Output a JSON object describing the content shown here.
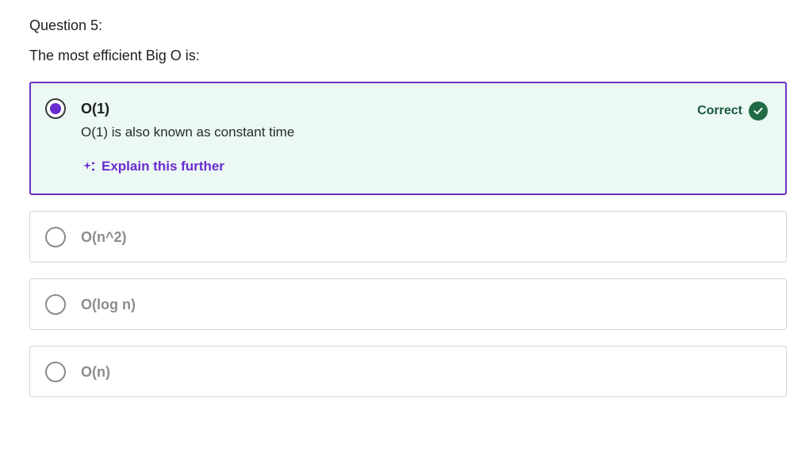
{
  "question": {
    "number_label": "Question 5:",
    "prompt": "The most efficient Big O is:"
  },
  "options": [
    {
      "label": "O(1)",
      "selected": true,
      "feedback": "O(1) is also known as constant time",
      "status_label": "Correct",
      "status_icon": "check-circle-icon",
      "explain_label": "Explain this further",
      "explain_icon": "sparkle-icon"
    },
    {
      "label": "O(n^2)",
      "selected": false
    },
    {
      "label": "O(log n)",
      "selected": false
    },
    {
      "label": "O(n)",
      "selected": false
    }
  ],
  "colors": {
    "accent": "#6a2bd0",
    "selected_border": "#6a34c5",
    "selected_background": "#ebf8f4",
    "correct_text": "#1d5a3c",
    "correct_icon": "#1f6b45",
    "unselected_text": "#8c8c8c"
  }
}
